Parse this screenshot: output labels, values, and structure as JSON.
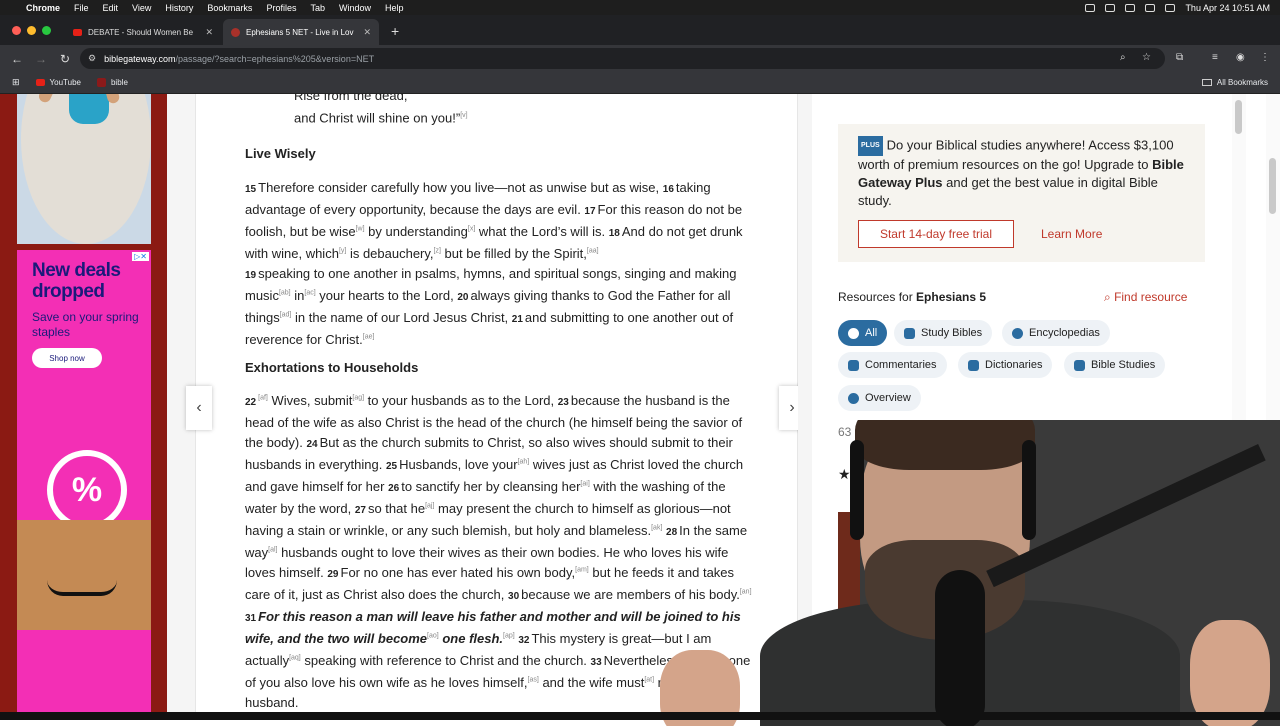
{
  "menubar": {
    "app": "Chrome",
    "items": [
      "File",
      "Edit",
      "View",
      "History",
      "Bookmarks",
      "Profiles",
      "Tab",
      "Window",
      "Help"
    ],
    "datetime": "Thu Apr 24  10:51 AM"
  },
  "tabs": [
    {
      "title": "DEBATE - Should Women Be"
    },
    {
      "title": "Ephesians 5 NET - Live in Lov"
    }
  ],
  "address": {
    "site": "biblegateway.com",
    "path": "/passage/?search=ephesians%205&version=NET"
  },
  "bookmarks": {
    "items": [
      "YouTube",
      "bible"
    ],
    "all": "All Bookmarks"
  },
  "ad": {
    "headline": "New deals dropped",
    "sub": "Save on your spring staples",
    "button": "Shop now",
    "pct": "%"
  },
  "passage": {
    "poem1": "Rise from the dead,",
    "poem2": "and Christ will shine on you!”",
    "poem2_fn": "[v]",
    "heading1": "Live Wisely",
    "heading2": "Exhortations to Households"
  },
  "side": {
    "promo_badge": "PLUS",
    "promo_text1": "Do your Biblical studies anywhere! Access $3,100 worth of premium resources on the go! Upgrade to ",
    "promo_bold": "Bible Gateway Plus",
    "promo_text2": " and get the best value in digital Bible study.",
    "trial": "Start 14-day free trial",
    "learn": "Learn More",
    "res_prefix": "Resources for ",
    "res_book": "Ephesians 5",
    "find": "Find resource",
    "chips": [
      "All",
      "Study Bibles",
      "Encyclopedias",
      "Commentaries",
      "Dictionaries",
      "Bible Studies",
      "Overview"
    ],
    "count": "63 res"
  }
}
